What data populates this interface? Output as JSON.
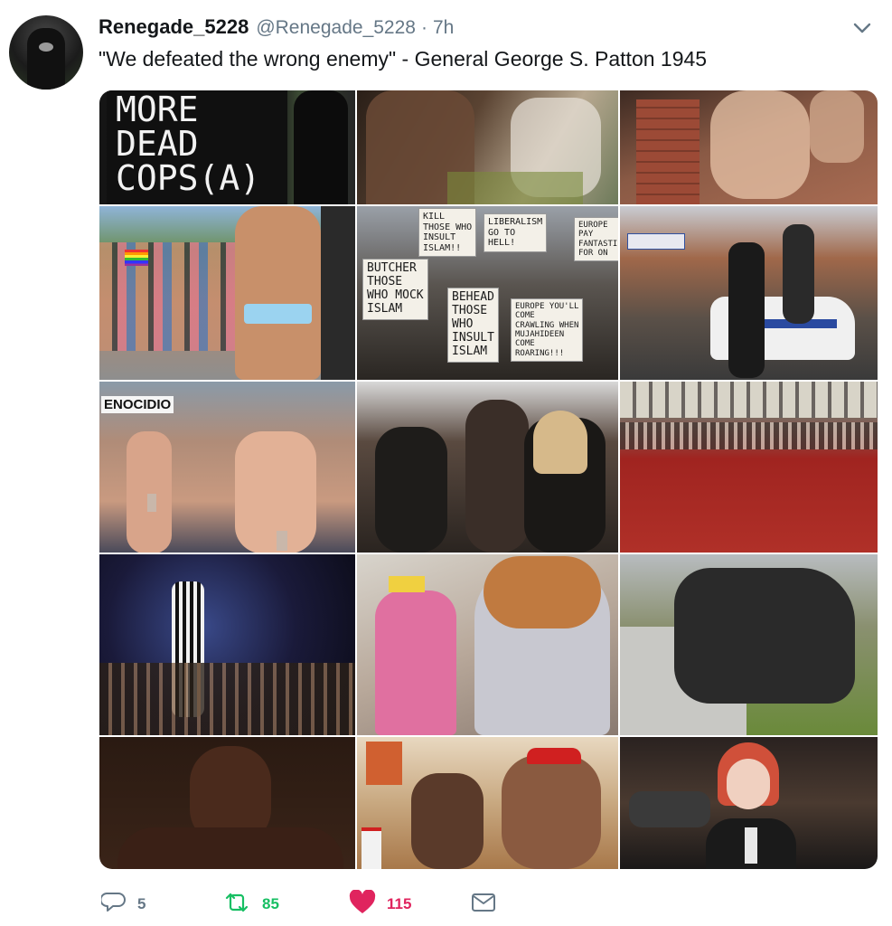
{
  "tweet": {
    "display_name": "Renegade_5228",
    "handle": "@Renegade_5228",
    "separator": "·",
    "time": "7h",
    "text": "\"We defeated the wrong enemy\" - General George S. Patton 1945"
  },
  "media": {
    "tiles": [
      {
        "caption": "MORE\nDEAD\nCOPS(A)"
      },
      {},
      {},
      {},
      {
        "signs": [
          "KILL\nTHOSE WHO\nINSULT\nISLAM!!",
          "LIBERALISM\nGO TO\nHELL!",
          "BUTCHER\nTHOSE\nWHO MOCK\nISLAM",
          "BEHEAD\nTHOSE\nWHO\nINSULT\nISLAM",
          "EUROPE YOU'LL\nCOME\nCRAWLING WHEN\nMUJAHIDEEN\nCOME\nROARING!!!",
          "EUROPE\nPAY\nFANTASTIC\nFOR ON"
        ]
      },
      {},
      {
        "banner": "ENOCIDIO"
      },
      {},
      {},
      {},
      {},
      {},
      {},
      {},
      {}
    ]
  },
  "actions": {
    "replies": "5",
    "retweets": "85",
    "likes": "115"
  },
  "colors": {
    "text": "#14171a",
    "muted": "#657786",
    "retweet": "#17bf63",
    "like": "#e0245e"
  }
}
